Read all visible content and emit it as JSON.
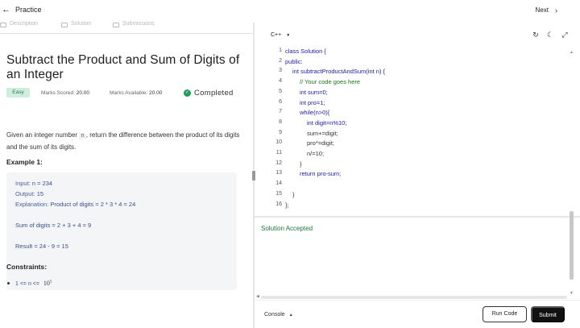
{
  "topbar": {
    "back_label": "Practice",
    "next_label": "Next"
  },
  "tabs": [
    {
      "label": "Description"
    },
    {
      "label": "Solution"
    },
    {
      "label": "Submissions"
    }
  ],
  "problem": {
    "title": "Subtract the Product and Sum of Digits of an Integer",
    "difficulty": "Easy",
    "marks_scored_label": "Marks Scored:",
    "marks_scored": "20.00",
    "marks_available_label": "Marks Available:",
    "marks_available": "20.00",
    "status": "Completed",
    "description_pre": "Given an integer number ",
    "description_var": "n",
    "description_post": ", return the difference between the product of its digits and the sum of its digits.",
    "example_title": "Example 1:",
    "example": {
      "input_label": "Input:",
      "input": " n = 234",
      "output_label": "Output:",
      "output": " 15",
      "explanation_label": "Explanation:",
      "explanation": " Product of digits = 2 * 3 * 4 = 24",
      "sum_line": "Sum of digits = 2 + 3 + 4 = 9",
      "result_line": "Result = 24 - 9 = 15"
    },
    "constraints_title": "Constraints:",
    "constraint": "1 <= n <= ",
    "constraint_base": "10",
    "constraint_exp": "5"
  },
  "editor": {
    "language": "C++",
    "icons": [
      "reset-icon",
      "theme-icon",
      "fullscreen-icon"
    ],
    "line_numbers": [
      "1",
      "2",
      "3",
      "4",
      "5",
      "6",
      "7",
      "8",
      "9",
      "10",
      "11",
      "12",
      "13",
      "14",
      "15",
      "16"
    ],
    "lines": [
      "class Solution {",
      "public:",
      "int subtractProductAndSum(int n) {",
      "// Your code goes here",
      "int sum=0;",
      "int pro=1;",
      "while(n>0){",
      "int digit=n%10;",
      "sum+=digit;",
      "pro*=digit;",
      "n/=10;",
      "}",
      "return pro-sum;",
      "",
      "}",
      "};"
    ]
  },
  "result_text": "Solution Accepted",
  "bottom": {
    "console_label": "Console",
    "run_label": "Run Code",
    "submit_label": "Submit"
  },
  "colors": {
    "accepted": "#1a7a3a",
    "easy_badge_bg": "#cfeede",
    "completed_check": "#1e9e5c",
    "submit_bg": "#111111"
  }
}
